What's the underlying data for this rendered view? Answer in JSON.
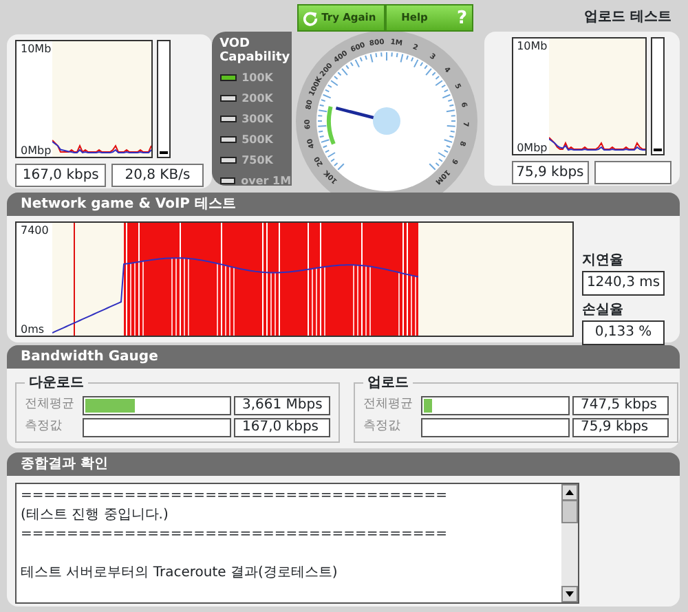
{
  "download_test": {
    "graph_labels": [
      "10Mb",
      "0Mbp"
    ],
    "readouts": [
      "167,0 kbps",
      "20,8 KB/s"
    ]
  },
  "vod_capability": {
    "title": "VOD Capability",
    "items": [
      {
        "label": "100K",
        "selected": true
      },
      {
        "label": "200K",
        "selected": false
      },
      {
        "label": "300K",
        "selected": false
      },
      {
        "label": "500K",
        "selected": false
      },
      {
        "label": "750K",
        "selected": false
      },
      {
        "label": "over 1M",
        "selected": false
      }
    ]
  },
  "gauge": {
    "buttons": [
      {
        "label": "Try Again",
        "kind": "refresh"
      },
      {
        "label": "Help",
        "kind": "help",
        "icon": "?"
      }
    ],
    "dial_labels": [
      "10K",
      "20",
      "40",
      "60",
      "80",
      "100K",
      "200",
      "400",
      "600",
      "800",
      "1M",
      "2",
      "3",
      "4",
      "5",
      "6",
      "7",
      "8",
      "9",
      "10M"
    ]
  },
  "upload_test": {
    "title": "업로드 테스트",
    "graph_labels": [
      "10Mb",
      "0Mbp"
    ],
    "readouts": [
      "75,9 kbps"
    ]
  },
  "voip": {
    "title": "Network game & VoIP 테스트",
    "graph_labels": [
      "7400",
      "0ms"
    ],
    "stats": [
      {
        "label": "지연율",
        "value": "1240,3 ms"
      },
      {
        "label": "손실율",
        "value": "0,133 %"
      }
    ]
  },
  "bandwidth": {
    "title": "Bandwidth Gauge",
    "groups": [
      {
        "title": "다운로드",
        "rows": [
          {
            "label": "전체평균",
            "level": 0.35,
            "value": "3,661 Mbps"
          },
          {
            "label": "측정값",
            "level": 0,
            "value": "167,0 kbps"
          }
        ]
      },
      {
        "title": "업로드",
        "rows": [
          {
            "label": "전체평균",
            "level": 0.06,
            "value": "747,5 kbps"
          },
          {
            "label": "측정값",
            "level": 0,
            "value": "75,9 kbps"
          }
        ]
      }
    ]
  },
  "results": {
    "title": "종합결과 확인",
    "lines": [
      {
        "text": "=====================================",
        "space_before": false
      },
      {
        "text": "(테스트 진행 중입니다.)",
        "space_before": false
      },
      {
        "text": "=====================================",
        "space_before": false
      },
      {
        "text": "테스트 서버로부터의 Traceroute 결과(경로테스트)",
        "space_before": true
      }
    ]
  }
}
